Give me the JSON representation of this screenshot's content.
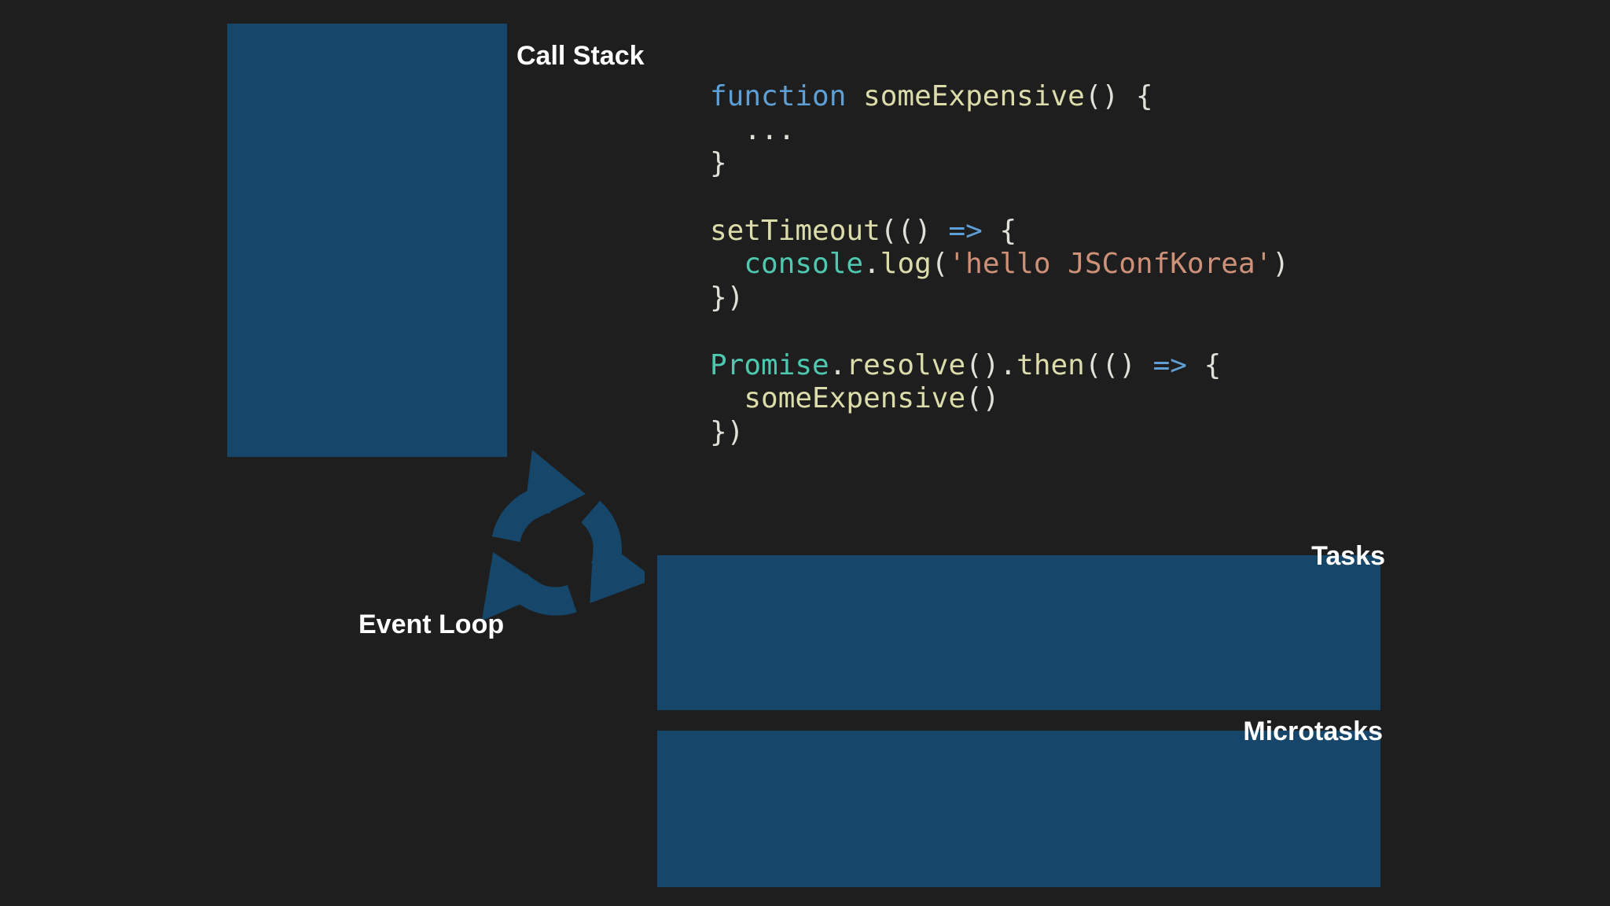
{
  "labels": {
    "call_stack": "Call Stack",
    "event_loop": "Event Loop",
    "tasks": "Tasks",
    "microtasks": "Microtasks"
  },
  "code": {
    "l1_kw": "function",
    "l1_fn": "someExpensive",
    "l1_rest": "() {",
    "l2": "  ...",
    "l3": "}",
    "l5_fn": "setTimeout",
    "l5_a": "(() ",
    "l5_arrow": "=>",
    "l5_b": " {",
    "l6_indent": "  ",
    "l6_obj": "console",
    "l6_dot": ".",
    "l6_fn": "log",
    "l6_open": "(",
    "l6_str": "'hello JSConfKorea'",
    "l6_close": ")",
    "l7": "})",
    "l9_obj": "Promise",
    "l9_dot1": ".",
    "l9_fn1": "resolve",
    "l9_a": "().",
    "l9_fn2": "then",
    "l9_b": "(() ",
    "l9_arrow": "=>",
    "l9_c": " {",
    "l10_indent": "  ",
    "l10_fn": "someExpensive",
    "l10_rest": "()",
    "l11": "})"
  },
  "colors": {
    "background": "#1e1e1f",
    "box": "#16476a",
    "keyword": "#5ea0d6",
    "function": "#dcdcaa",
    "object": "#4ec9b0",
    "string": "#ce9178"
  },
  "icons": {
    "event_loop": "circular-arrows-icon"
  }
}
